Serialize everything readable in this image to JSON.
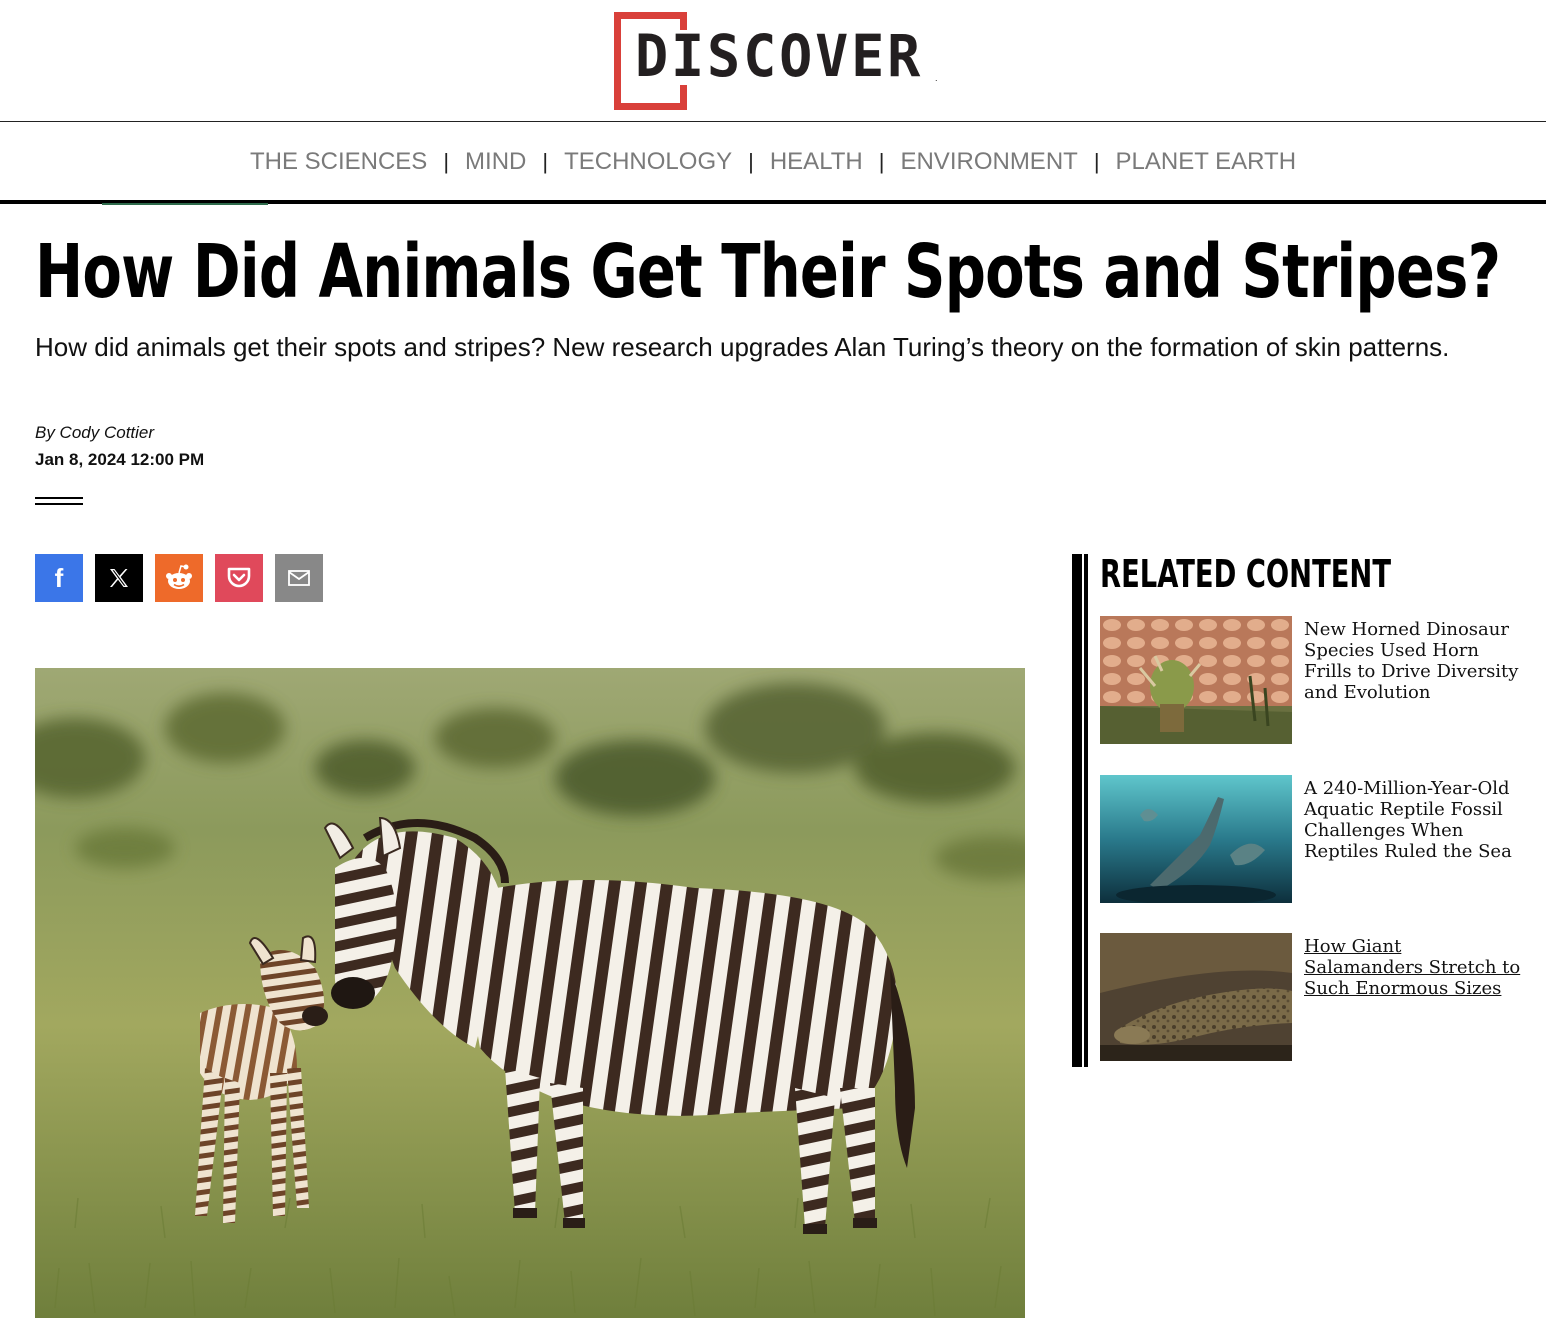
{
  "brand": {
    "logo_text": "DISCOVER",
    "logo_mark": ".",
    "accent_color": "#d9403a"
  },
  "nav": {
    "items": [
      "THE SCIENCES",
      "MIND",
      "TECHNOLOGY",
      "HEALTH",
      "ENVIRONMENT",
      "PLANET EARTH"
    ],
    "separator": "|"
  },
  "article": {
    "title": "How Did Animals Get Their Spots and Stripes?",
    "dek": "How did animals get their spots and stripes? New research upgrades Alan Turing’s theory on the formation of skin patterns.",
    "byline": "By Cody Cottier",
    "date": "Jan 8, 2024 12:00 PM"
  },
  "share": [
    {
      "icon": "facebook-icon",
      "color": "#3b76e8",
      "glyph": "f"
    },
    {
      "icon": "x-icon",
      "color": "#000000",
      "glyph": "𝕏"
    },
    {
      "icon": "reddit-icon",
      "color": "#ee6a2a",
      "glyph": ""
    },
    {
      "icon": "pocket-icon",
      "color": "#e0495b",
      "glyph": ""
    },
    {
      "icon": "email-icon",
      "color": "#888888",
      "glyph": ""
    }
  ],
  "related": {
    "heading": "RELATED CONTENT",
    "items": [
      {
        "title": "New Horned Dinosaur Species Used Horn Frills to Drive Diversity and Evolution"
      },
      {
        "title": "A 240-Million-Year-Old Aquatic Reptile Fossil Challenges When Reptiles Ruled the Sea"
      },
      {
        "title": "How Giant Salamanders Stretch to Such Enormous Sizes"
      }
    ]
  }
}
